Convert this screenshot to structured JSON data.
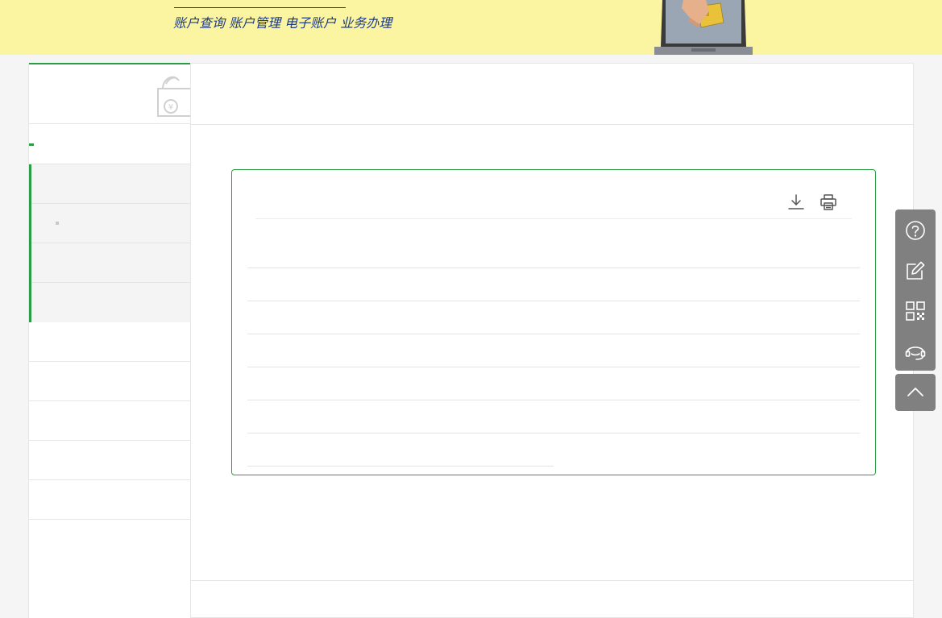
{
  "banner": {
    "slogan": "账户查询 账户管理 电子账户 业务办理"
  },
  "colors": {
    "accent": "#2a9d45",
    "banner_bg": "#fbf5a2",
    "slogan": "#1a3a8a",
    "float_bg": "#808080"
  },
  "sidebar": {
    "header_icon": "wallet-icon",
    "group_label": "",
    "sub_items": [
      "",
      "",
      "",
      ""
    ],
    "items": [
      "",
      "",
      "",
      "",
      ""
    ]
  },
  "main": {
    "title": "",
    "toolbar": {
      "download_icon": "download-icon",
      "print_icon": "print-icon"
    },
    "rows": [
      "",
      "",
      "",
      "",
      "",
      "",
      ""
    ]
  },
  "float_tools": {
    "icons": [
      "help-icon",
      "edit-icon",
      "qrcode-icon",
      "customer-service-icon",
      "back-to-top-icon"
    ]
  }
}
